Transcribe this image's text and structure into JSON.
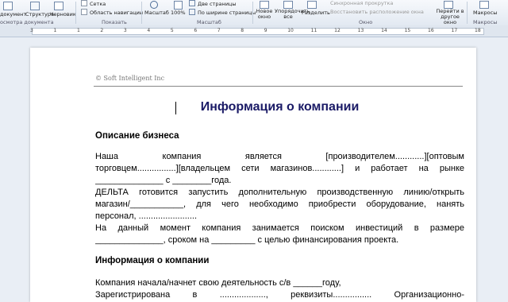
{
  "ribbon": {
    "views": [
      "документ",
      "Структура",
      "Черновик"
    ],
    "views_group_label": "осмотра документа",
    "show_grid": "Сетка",
    "show_nav": "Область навигации",
    "show_group_label": "Показать",
    "zoom_button": "Масштаб",
    "zoom_100": "100%",
    "two_pages": "Две страницы",
    "page_width": "По ширине страницы",
    "zoom_group_label": "Масштаб",
    "new_window": "Новое окно",
    "arrange_all": "Упорядочить все",
    "split": "Разделить",
    "sync_scroll": "Синхронная прокрутка",
    "restore_layout": "Восстановить расположение окна",
    "window_group_label": "Окно",
    "switch_window": "Перейти в другое окно",
    "macros": "Макросы",
    "macros_group_label": "Макросы"
  },
  "ruler": {
    "numbers": [
      "3",
      "1",
      "1",
      "2",
      "3",
      "4",
      "5",
      "6",
      "7",
      "8",
      "9",
      "10",
      "11",
      "12",
      "13",
      "14",
      "15",
      "16",
      "17",
      "18"
    ]
  },
  "document": {
    "header": "© Soft Intelligent Inc",
    "title": "Информация о компании",
    "section1_heading": "Описание бизнеса",
    "p1_line1": "Наша компания является [производителем............][оптовым",
    "p1_line2": "торговцем................][владельцем сети магазинов............] и работает на рынке",
    "p1_line3": "______________ с ________года.",
    "p2_line1": "ДЕЛЬТА готовится запустить дополнительную производственную линию/открыть",
    "p2_line2": "магазин/___________, для чего необходимо приобрести оборудование, нанять",
    "p2_line3": "персонал, ........................",
    "p3_line1": "На данный момент компания занимается поиском инвестиций в размере",
    "p3_line2": "______________, сроком на _________ с целью финансирования проекта.",
    "section2_heading": "Информация о компании",
    "p4_line1": "Компания начала/начнет свою деятельность с/в ______году,",
    "p4_line2": "Зарегистрирована в ..................., реквизиты................ Организационно-"
  }
}
